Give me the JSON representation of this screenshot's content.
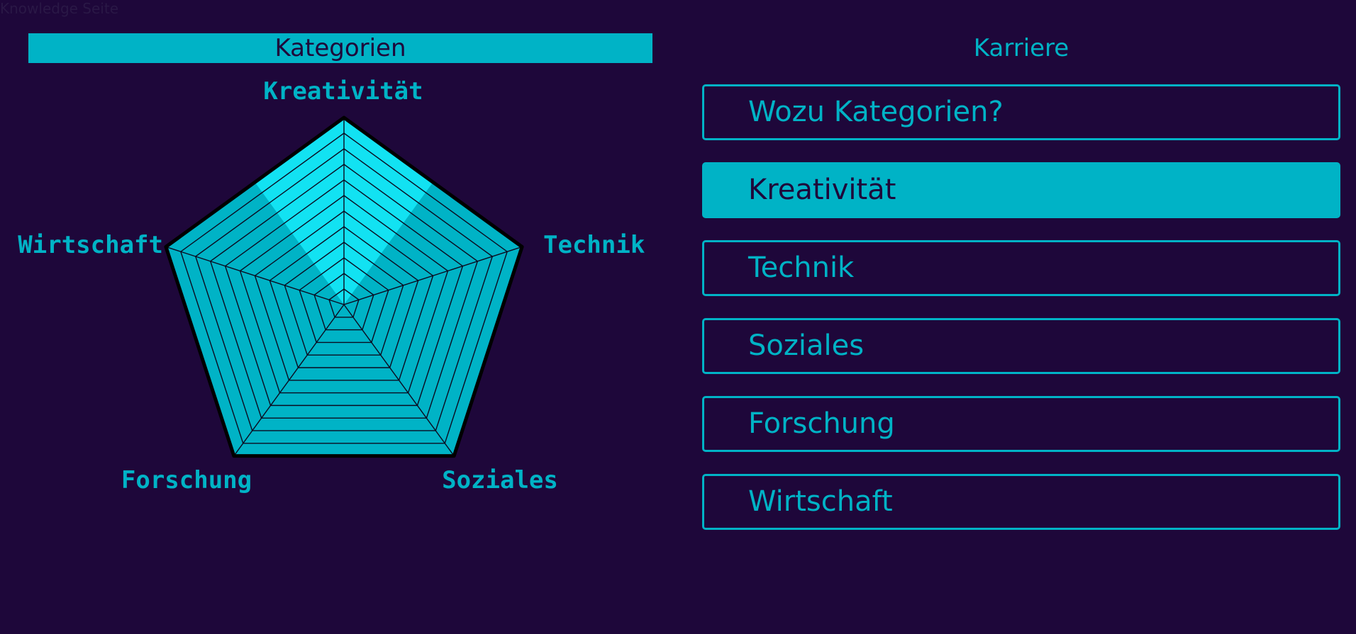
{
  "page": {
    "label": "Knowledge Seite"
  },
  "left_panel": {
    "title": "Kategorien"
  },
  "right_panel": {
    "title": "Karriere"
  },
  "radar": {
    "axes": [
      "Kreativität",
      "Technik",
      "Soziales",
      "Forschung",
      "Wirtschaft"
    ],
    "highlighted_axis": "Kreativität",
    "ring_count": 12,
    "colors": {
      "fill": "#00b3c6",
      "highlight": "#12e2f2",
      "grid": "#0b0b20",
      "label": "#00b3c6"
    }
  },
  "menu": {
    "items": [
      {
        "label": "Wozu Kategorien?",
        "active": false
      },
      {
        "label": "Kreativität",
        "active": true
      },
      {
        "label": "Technik",
        "active": false
      },
      {
        "label": "Soziales",
        "active": false
      },
      {
        "label": "Forschung",
        "active": false
      },
      {
        "label": "Wirtschaft",
        "active": false
      }
    ]
  },
  "colors": {
    "background": "#1e073a",
    "accent": "#00b3c6",
    "text_dark": "#1e073a"
  }
}
